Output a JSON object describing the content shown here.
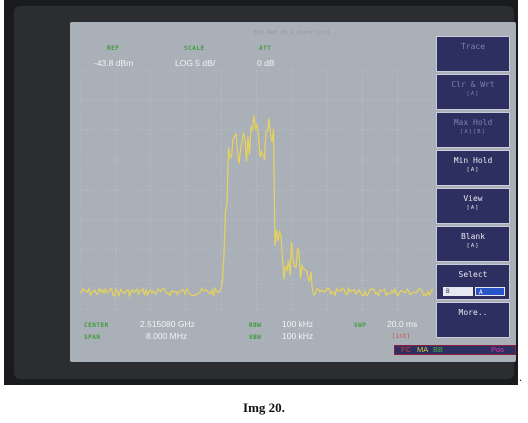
{
  "header_status": "Ext Ref Ch 1 Instr Ctrl ...",
  "readouts": {
    "ref_label": "REF",
    "ref_value": "-43.8 dBm",
    "scale_label": "SCALE",
    "scale_value": "LOG  5 dB/",
    "att_label": "ATT",
    "att_value": "0 dB",
    "center_label": "CENTER",
    "center_value": "2.515080 GHz",
    "span_label": "SPAN",
    "span_value": "8.000 MHz",
    "rbw_label": "RBW",
    "rbw_value": "100 kHz",
    "vbw_label": "VBW",
    "vbw_value": "100 kHz",
    "swp_label": "SWP",
    "swp_value": "20.0 ms",
    "swp_mode": "[int]"
  },
  "softkeys": [
    {
      "label": "Trace",
      "sub": "",
      "dim": true
    },
    {
      "label": "Clr & Wrt",
      "sub": "[A]",
      "dim": true
    },
    {
      "label": "Max Hold",
      "sub": "[A][B]",
      "dim": true
    },
    {
      "label": "Min Hold",
      "sub": "[A]",
      "dim": false
    },
    {
      "label": "View",
      "sub": "[A]",
      "dim": false
    },
    {
      "label": "Blank",
      "sub": "[A]",
      "dim": false
    },
    {
      "label": "Select",
      "sub": "",
      "dim": false,
      "options": [
        "B",
        "A"
      ]
    },
    {
      "label": "More..",
      "sub": "",
      "dim": false
    }
  ],
  "status_bar": {
    "fc": "FC",
    "ma": "MA",
    "bb": "BB",
    "pos": "Pos"
  },
  "caption": "Img 20.",
  "trailing_mark": ".",
  "colors": {
    "trace": "#e8d35a",
    "label": "#3f9a3a",
    "key_bg": "#2c2f60",
    "screen": "#a9b0b8"
  }
}
